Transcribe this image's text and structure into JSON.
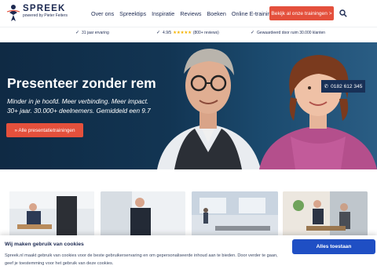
{
  "header": {
    "logo_title": "SPREEK",
    "logo_sub": "powered by Pieter Feiters",
    "nav": [
      "Over ons",
      "Spreektips",
      "Inspiratie",
      "Reviews",
      "Boeken",
      "Online E-trainingen"
    ],
    "cta_label": "Bekijk al onze trainingen >",
    "search_icon": "search-icon"
  },
  "trust": {
    "years": "31 jaar ervaring",
    "rating": "4.9/5",
    "reviews": "(800+ reviews)",
    "customers": "Gewaardeerd door ruim 30.000 klanten"
  },
  "hero": {
    "phone": "0182 612 345",
    "title": "Presenteer zonder rem",
    "subtitle_line1": "Minder in je hoofd. Meer verbinding. Meer impact.",
    "subtitle_line2": "30+ jaar. 30.000+ deelnemers. Gemiddeld een 9.7",
    "button_label": "» Alle presentatietrainingen"
  },
  "cookie": {
    "title": "Wij maken gebruik van cookies",
    "text": "Spreek.nl maakt gebruik van cookies voor de beste gebruikerservaring en om gepersonaliseerde inhoud aan te bieden. Door verder te gaan, geef je toestemming voor het gebruik van deze cookies.",
    "accept_label": "Alles toestaan"
  },
  "colors": {
    "brand_navy": "#1d2a52",
    "accent_red": "#e4503c",
    "accept_blue": "#1f4fc4",
    "star": "#f5b301"
  }
}
